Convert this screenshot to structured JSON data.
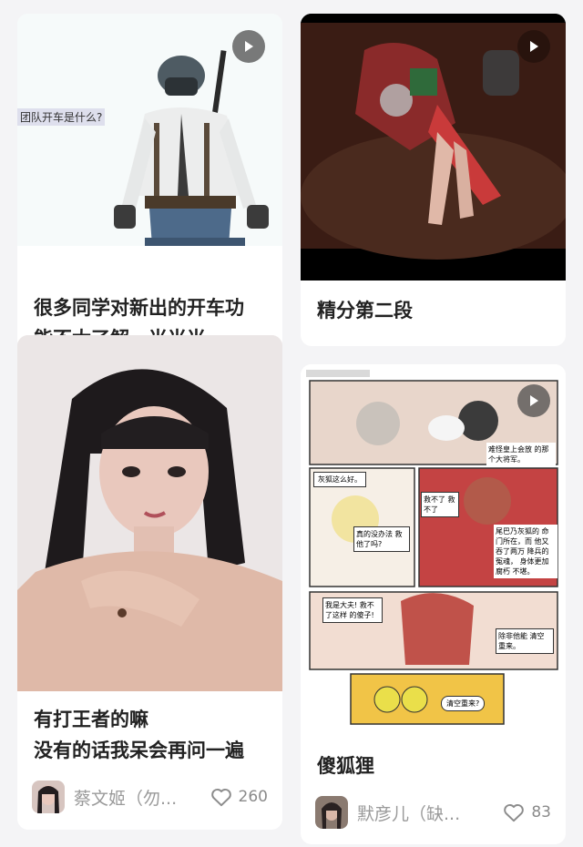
{
  "feed": {
    "cards": [
      {
        "title_line1": "很多同学对新出的开车功",
        "title_line2": "能不太了解，当当当",
        "overlay_text": "团队开车是什么?",
        "play_icon": "play-icon"
      },
      {
        "title": "精分第二段",
        "play_icon": "play-icon"
      },
      {
        "title_line1": "有打王者的嘛",
        "title_line2": "没有的话我呆会再问一遍",
        "author": "蔡文姬（勿...",
        "likes": "260"
      },
      {
        "title": "傻狐狸",
        "author": "默彦儿（缺...",
        "likes": "83",
        "play_icon": "play-icon",
        "comic_texts": [
          "灰狐这么好。",
          "救不了 救不了",
          "真的没办法 救他了吗?",
          "难怪皇上会放 的那个大将军。",
          "尾巴乃灰狐的 命门所在，而 他又吞了两万 降兵的冤魂， 身体更加腐朽 不堪。",
          "我是大夫! 救不了这样 的傻子!",
          "除非他能 清空重来。",
          "清空重来?"
        ]
      }
    ]
  },
  "colors": {
    "background": "#f4f4f6",
    "card": "#ffffff",
    "title": "#222222",
    "muted": "#9a9a9a"
  }
}
